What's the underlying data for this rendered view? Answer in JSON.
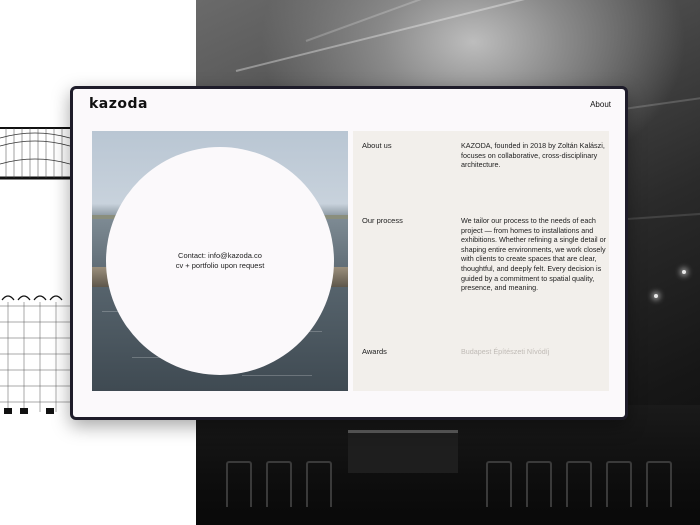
{
  "site": {
    "logo": "kazoda",
    "nav": {
      "about": "About"
    }
  },
  "contact": {
    "line1": "Contact: info@kazoda.co",
    "line2": "cv + portfolio upon request"
  },
  "info": {
    "about_label": "About us",
    "about_text": "KAZODA, founded in 2018 by Zoltán Kalászi, focuses on collaborative, cross-disciplinary architecture.",
    "process_label": "Our process",
    "process_text": "We tailor our process to the needs of each project — from homes to installations and exhibitions. Whether refining a single detail or shaping entire environments, we work closely with clients to create spaces that are clear, thoughtful, and deeply felt. Every decision is guided by a commitment to spatial quality, presence, and meaning.",
    "awards_label": "Awards",
    "awards_text": "Budapest Építészeti Nívódíj"
  },
  "colors": {
    "window_frame": "#1e1c2a",
    "window_bg": "#fbf9fb",
    "info_panel_bg": "#f2efeb",
    "muted_text": "#c0bbb6"
  }
}
